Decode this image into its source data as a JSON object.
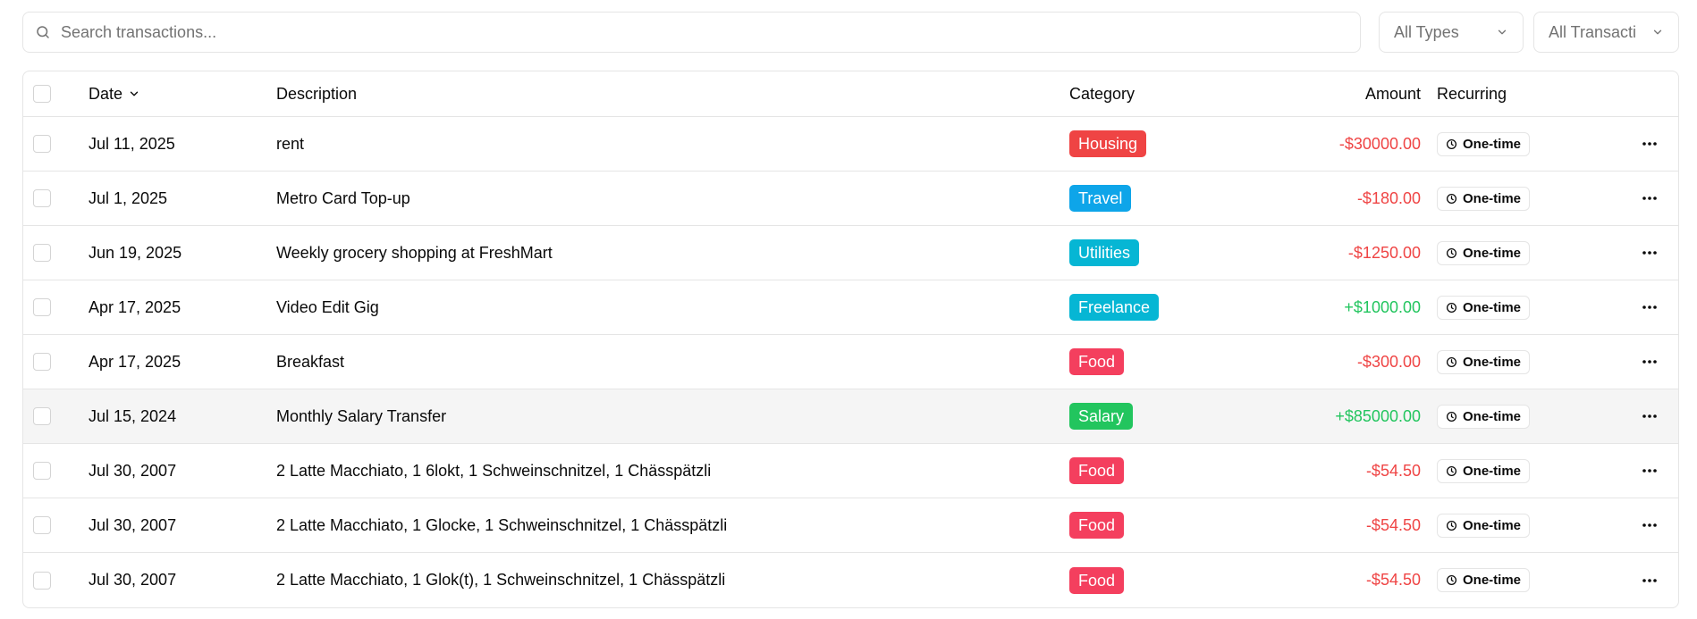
{
  "search": {
    "placeholder": "Search transactions..."
  },
  "filters": {
    "types_label": "All Types",
    "transactions_label": "All Transacti"
  },
  "table": {
    "headers": {
      "date": "Date",
      "description": "Description",
      "category": "Category",
      "amount": "Amount",
      "recurring": "Recurring"
    },
    "rows": [
      {
        "date": "Jul 11, 2025",
        "description": "rent",
        "category": "Housing",
        "category_color": "#ef4444",
        "amount": "-$30000.00",
        "amount_color": "#ef4444",
        "recurring": "One-time"
      },
      {
        "date": "Jul 1, 2025",
        "description": "Metro Card Top-up",
        "category": "Travel",
        "category_color": "#0ea5e9",
        "amount": "-$180.00",
        "amount_color": "#ef4444",
        "recurring": "One-time"
      },
      {
        "date": "Jun 19, 2025",
        "description": "Weekly grocery shopping at FreshMart",
        "category": "Utilities",
        "category_color": "#06b6d4",
        "amount": "-$1250.00",
        "amount_color": "#ef4444",
        "recurring": "One-time"
      },
      {
        "date": "Apr 17, 2025",
        "description": "Video Edit Gig",
        "category": "Freelance",
        "category_color": "#06b6d4",
        "amount": "+$1000.00",
        "amount_color": "#22c55e",
        "recurring": "One-time"
      },
      {
        "date": "Apr 17, 2025",
        "description": "Breakfast",
        "category": "Food",
        "category_color": "#f43f5e",
        "amount": "-$300.00",
        "amount_color": "#ef4444",
        "recurring": "One-time"
      },
      {
        "date": "Jul 15, 2024",
        "description": "Monthly Salary Transfer",
        "category": "Salary",
        "category_color": "#22c55e",
        "amount": "+$85000.00",
        "amount_color": "#22c55e",
        "recurring": "One-time"
      },
      {
        "date": "Jul 30, 2007",
        "description": "2 Latte Macchiato, 1 6lokt, 1 Schweinschnitzel, 1 Chässpätzli",
        "category": "Food",
        "category_color": "#f43f5e",
        "amount": "-$54.50",
        "amount_color": "#ef4444",
        "recurring": "One-time"
      },
      {
        "date": "Jul 30, 2007",
        "description": "2 Latte Macchiato, 1 Glocke, 1 Schweinschnitzel, 1 Chässpätzli",
        "category": "Food",
        "category_color": "#f43f5e",
        "amount": "-$54.50",
        "amount_color": "#ef4444",
        "recurring": "One-time"
      },
      {
        "date": "Jul 30, 2007",
        "description": "2 Latte Macchiato, 1 Glok(t), 1 Schweinschnitzel, 1 Chässpätzli",
        "category": "Food",
        "category_color": "#f43f5e",
        "amount": "-$54.50",
        "amount_color": "#ef4444",
        "recurring": "One-time"
      }
    ]
  },
  "icons": {
    "search": "search-icon",
    "chevron": "chevron-down-icon",
    "clock": "clock-icon",
    "more": "more-horizontal-icon"
  }
}
